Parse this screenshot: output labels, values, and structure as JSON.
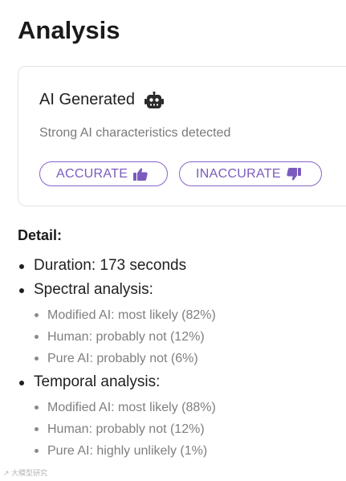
{
  "page": {
    "title": "Analysis"
  },
  "result": {
    "label": "AI Generated",
    "icon": "robot-icon",
    "subtitle": "Strong AI characteristics detected",
    "buttons": {
      "accurate": {
        "label": "ACCURATE",
        "icon": "thumbs-up-icon"
      },
      "inaccurate": {
        "label": "INACCURATE",
        "icon": "thumbs-down-icon"
      }
    }
  },
  "detail": {
    "label": "Detail:",
    "duration": "Duration: 173 seconds",
    "spectral": {
      "label": "Spectral analysis:",
      "items": [
        "Modified AI: most likely (82%)",
        "Human: probably not (12%)",
        "Pure AI: probably not (6%)"
      ]
    },
    "temporal": {
      "label": "Temporal analysis:",
      "items": [
        "Modified AI: most likely (88%)",
        "Human: probably not (12%)",
        "Pure AI: highly unlikely (1%)"
      ]
    }
  },
  "watermark": "↗ 大模型研究",
  "colors": {
    "accent": "#7b5bbd",
    "border": "#e4e4e4",
    "muted": "#7a7a7a"
  }
}
